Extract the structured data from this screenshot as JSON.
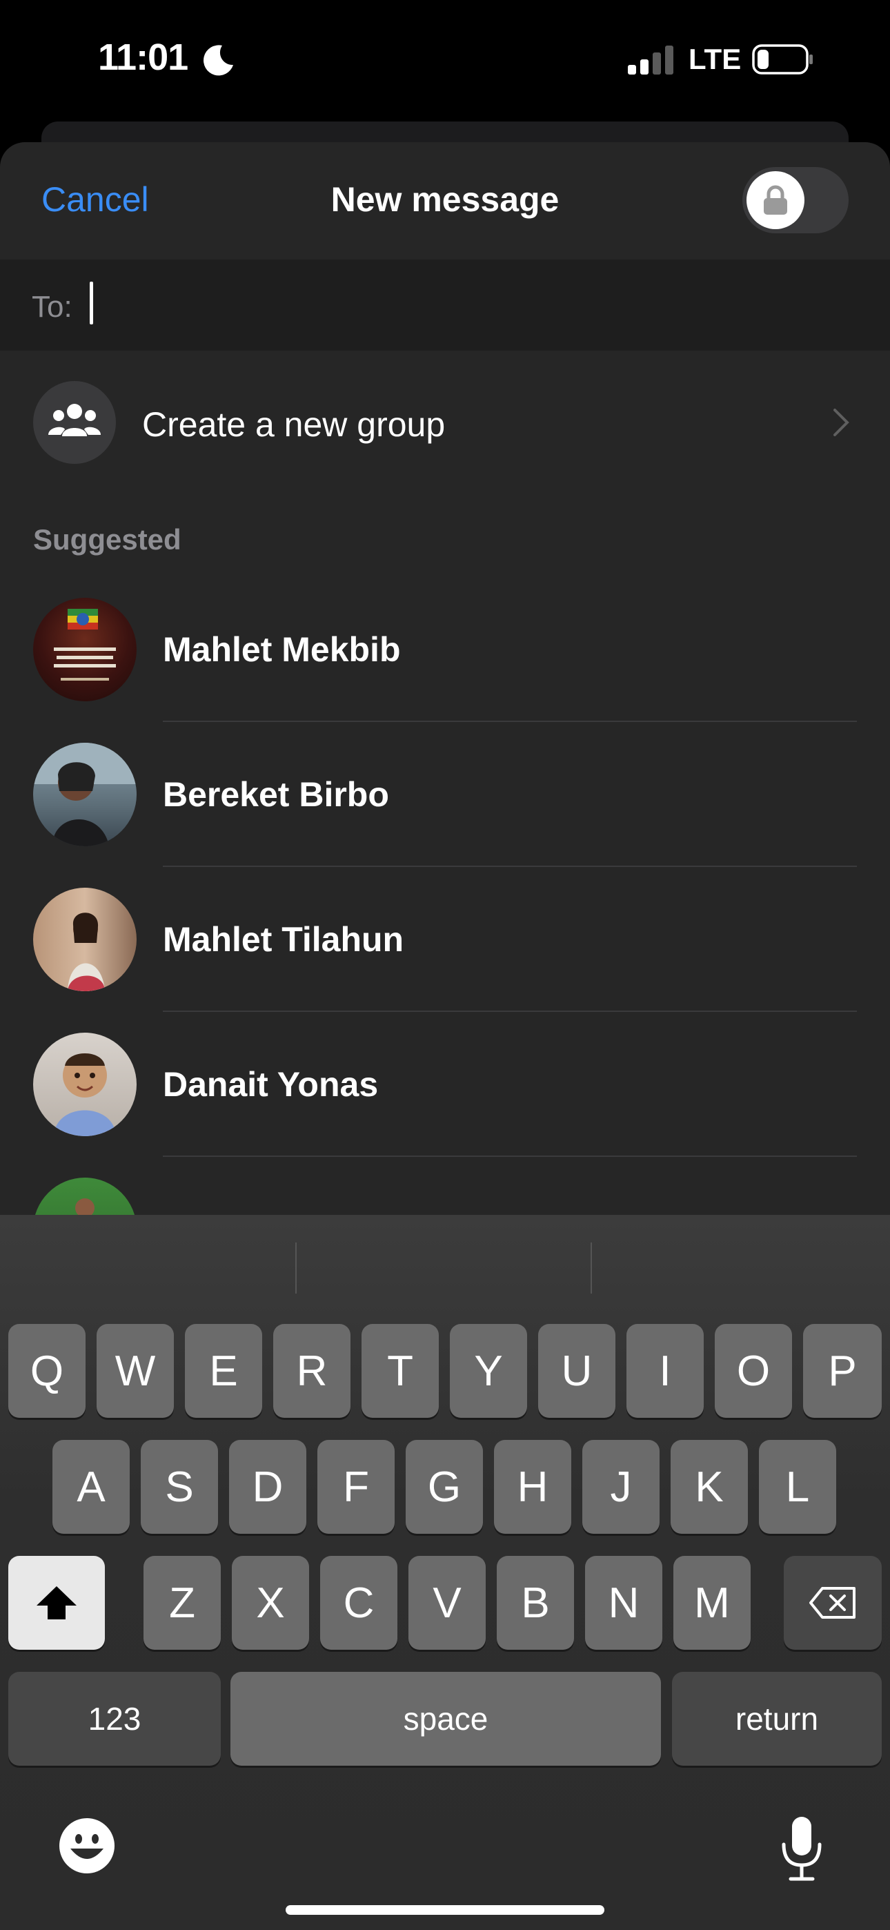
{
  "status_bar": {
    "time": "11:01",
    "network": "LTE"
  },
  "header": {
    "cancel_label": "Cancel",
    "title": "New message"
  },
  "to_field": {
    "label": "To:",
    "value": ""
  },
  "create_group": {
    "label": "Create a new group"
  },
  "suggested": {
    "heading": "Suggested",
    "contacts": [
      {
        "name": "Mahlet Mekbib"
      },
      {
        "name": "Bereket Birbo"
      },
      {
        "name": "Mahlet Tilahun"
      },
      {
        "name": "Danait Yonas"
      }
    ]
  },
  "keyboard": {
    "row1": [
      "Q",
      "W",
      "E",
      "R",
      "T",
      "Y",
      "U",
      "I",
      "O",
      "P"
    ],
    "row2": [
      "A",
      "S",
      "D",
      "F",
      "G",
      "H",
      "J",
      "K",
      "L"
    ],
    "row3": [
      "Z",
      "X",
      "C",
      "V",
      "B",
      "N",
      "M"
    ],
    "numbers_label": "123",
    "space_label": "space",
    "return_label": "return"
  },
  "colors": {
    "accent": "#3a8df5",
    "sheet_bg": "#262626",
    "key_bg": "#6b6b6b"
  }
}
